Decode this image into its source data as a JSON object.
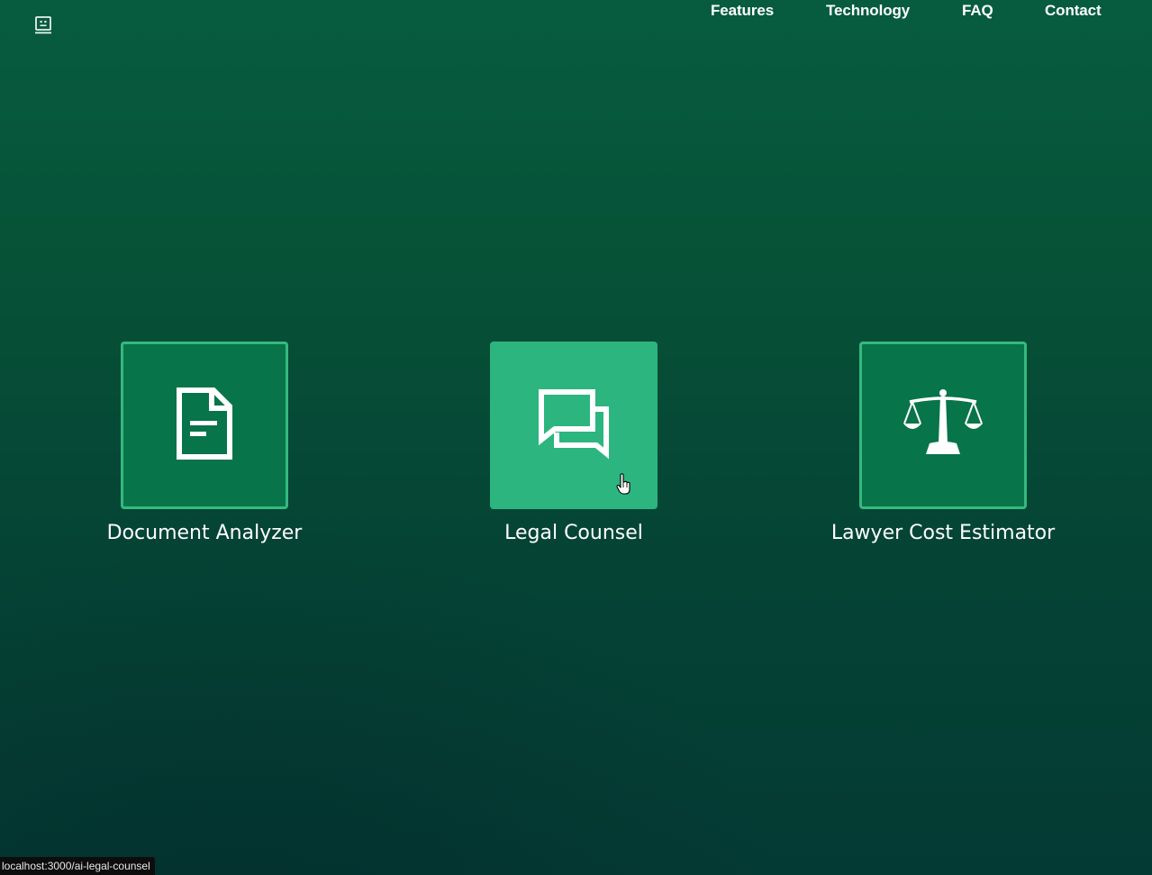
{
  "nav": {
    "links": [
      {
        "label": "Features"
      },
      {
        "label": "Technology"
      },
      {
        "label": "FAQ"
      },
      {
        "label": "Contact"
      }
    ]
  },
  "cards": [
    {
      "label": "Document Analyzer",
      "icon": "document-icon",
      "state": "default"
    },
    {
      "label": "Legal Counsel",
      "icon": "chat-bubbles-icon",
      "state": "hovered"
    },
    {
      "label": "Lawyer Cost Estimator",
      "icon": "scales-icon",
      "state": "default"
    }
  ],
  "status_bar": {
    "url": "localhost:3000/ai-legal-counsel"
  },
  "colors": {
    "background_top": "#075c40",
    "background_bottom": "#043a34",
    "card_fill": "#08744a",
    "card_border": "#35b97f",
    "card_active": "#2cb57f"
  }
}
